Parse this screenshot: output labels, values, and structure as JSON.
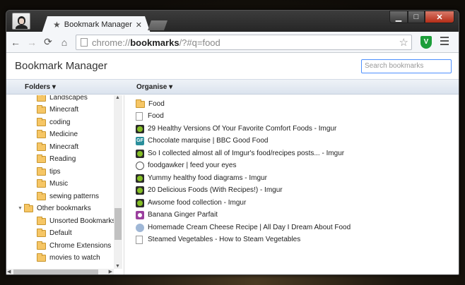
{
  "browser": {
    "tab_title": "Bookmark Manager",
    "url_scheme": "chrome://",
    "url_host": "bookmarks",
    "url_rest": "/?#q=food",
    "extension_label": "V"
  },
  "app": {
    "title": "Bookmark Manager",
    "search_placeholder": "Search bookmarks"
  },
  "columns": {
    "folders": "Folders ▾",
    "organise": "Organise ▾"
  },
  "tree": {
    "items": [
      {
        "label": "Landscapes"
      },
      {
        "label": "Minecraft"
      },
      {
        "label": "coding"
      },
      {
        "label": "Medicine"
      },
      {
        "label": "Minecraft"
      },
      {
        "label": "Reading"
      },
      {
        "label": "tips"
      },
      {
        "label": "Music"
      },
      {
        "label": "sewing patterns"
      },
      {
        "label": "Other bookmarks"
      },
      {
        "label": "Unsorted Bookmarks"
      },
      {
        "label": "Default"
      },
      {
        "label": "Chrome Extensions"
      },
      {
        "label": "movies to watch"
      }
    ]
  },
  "results": {
    "items": [
      {
        "label": "Food",
        "icon": "folder-icon"
      },
      {
        "label": "Food",
        "icon": "page-icon"
      },
      {
        "label": "29 Healthy Versions Of Your Favorite Comfort Foods - Imgur",
        "icon": "imgur-icon"
      },
      {
        "label": "Chocolate marquise | BBC Good Food",
        "icon": "good-food-icon"
      },
      {
        "label": "So I collected almost all of Imgur's food/recipes posts... - Imgur",
        "icon": "imgur-icon"
      },
      {
        "label": "foodgawker | feed your eyes",
        "icon": "foodgawker-icon"
      },
      {
        "label": "Yummy healthy food diagrams - Imgur",
        "icon": "imgur-icon"
      },
      {
        "label": "20 Delicious Foods (With Recipes!) - Imgur",
        "icon": "imgur-icon"
      },
      {
        "label": "Awsome food collection - Imgur",
        "icon": "imgur-icon"
      },
      {
        "label": "Banana Ginger Parfait",
        "icon": "banana-icon"
      },
      {
        "label": "Homemade Cream Cheese Recipe | All Day I Dream About Food",
        "icon": "globe-icon"
      },
      {
        "label": "Steamed Vegetables - How to Steam Vegetables",
        "icon": "page-icon"
      }
    ]
  }
}
